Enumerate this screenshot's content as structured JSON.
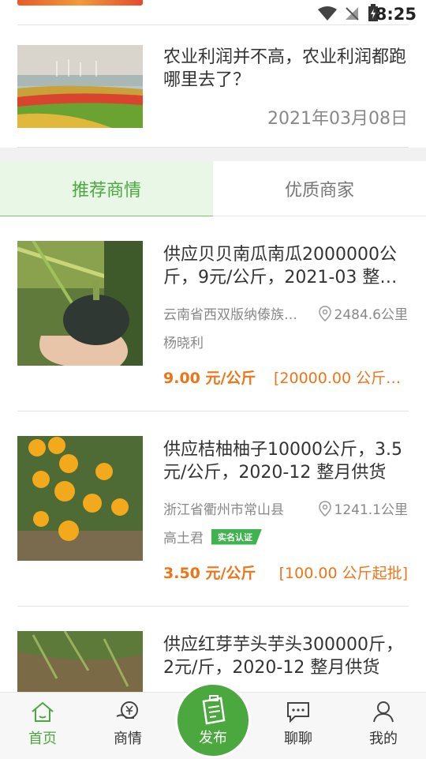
{
  "status_bar": {
    "time": "8:25"
  },
  "news": {
    "title": "农业利润并不高，农业利润都跑哪里去了？",
    "date": "2021年03月08日"
  },
  "tabs": [
    {
      "label": "推荐商情",
      "active": true
    },
    {
      "label": "优质商家",
      "active": false
    }
  ],
  "products": [
    {
      "title": "供应贝贝南瓜南瓜2000000公斤，9元/公斤，2021-03 整…",
      "location": "云南省西双版纳傣族…",
      "distance": "2484.6公里",
      "seller": "杨晓利",
      "badge": "",
      "price": "9.00 元/公斤",
      "moq": "[20000.00 公斤起…"
    },
    {
      "title": "供应桔柚柚子10000公斤，3.5元/公斤，2020-12 整月供货",
      "location": "浙江省衢州市常山县",
      "distance": "1241.1公里",
      "seller": "高土君",
      "badge": "实名认证",
      "price": "3.50 元/公斤",
      "moq": "[100.00 公斤起批]"
    },
    {
      "title": "供应红芽芋头芋头300000斤，2元/斤，2020-12 整月供货"
    }
  ],
  "bottom_nav": {
    "home": "首页",
    "market": "商情",
    "publish": "发布",
    "chat": "聊聊",
    "mine": "我的"
  },
  "colors": {
    "accent_green": "#4aa83f",
    "price_orange": "#ef7418"
  }
}
